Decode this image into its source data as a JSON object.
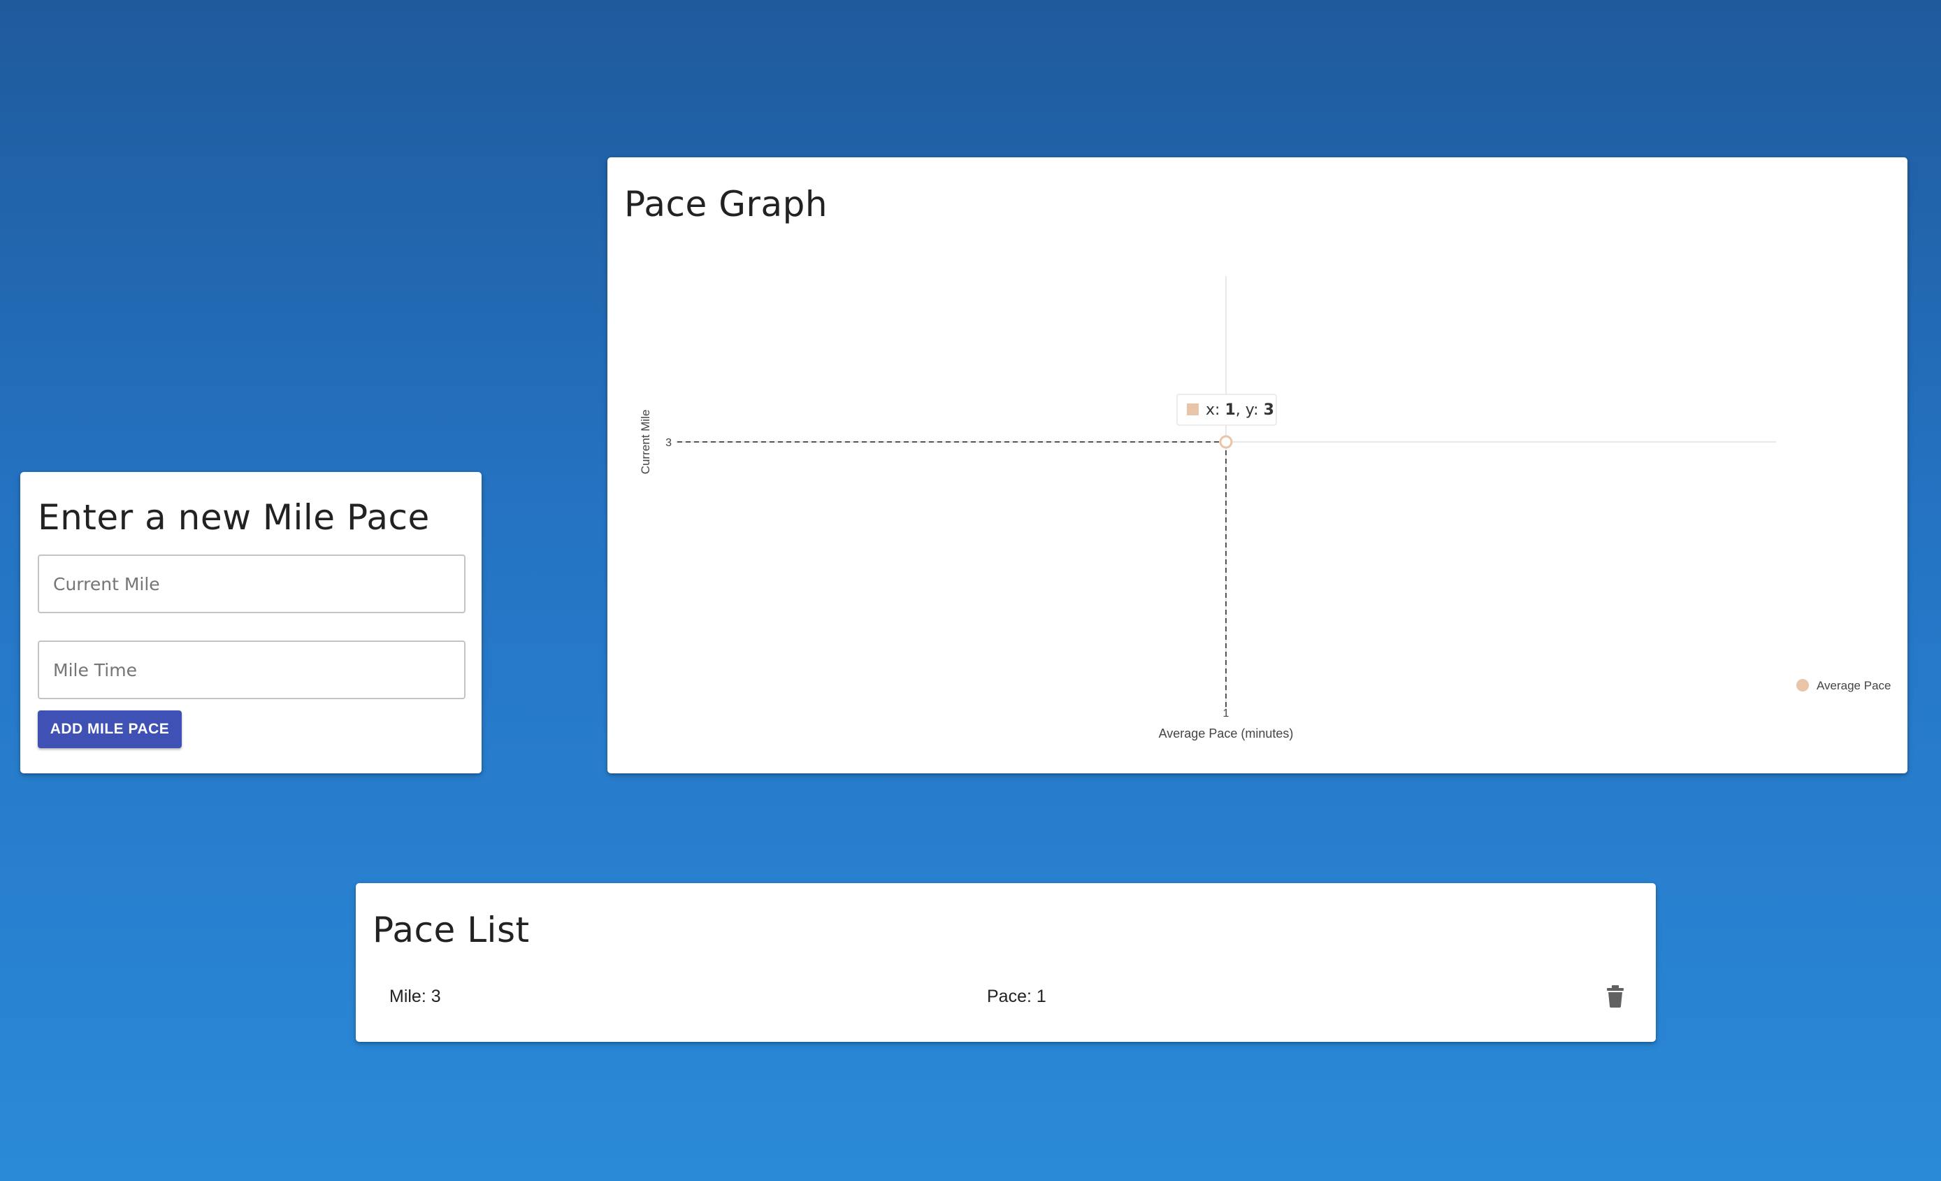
{
  "form": {
    "title": "Enter a new Mile Pace",
    "current_mile": {
      "placeholder": "Current Mile",
      "value": ""
    },
    "mile_time": {
      "placeholder": "Mile Time",
      "value": ""
    },
    "add_button_label": "Add Mile Pace",
    "accent_color": "#3f51b5"
  },
  "graph": {
    "title": "Pace Graph",
    "tooltip": {
      "x_label": "x: ",
      "x_value": "1",
      "sep": ", y: ",
      "y_value": "3"
    }
  },
  "chart_data": {
    "type": "scatter",
    "title": "",
    "xlabel": "Average Pace (minutes)",
    "ylabel": "Current Mile",
    "x_ticks": [
      "1"
    ],
    "y_ticks": [
      "3"
    ],
    "series": [
      {
        "name": "Average Pace",
        "color": "#e8c4a8",
        "points": [
          {
            "x": 1,
            "y": 3
          }
        ]
      }
    ],
    "grid": true,
    "legend_position": "bottom-right",
    "crosshair_on_point": true
  },
  "list": {
    "title": "Pace List",
    "items": [
      {
        "mile": "Mile: 3",
        "pace": "Pace: 1"
      }
    ],
    "delete_icon": "trash-icon"
  }
}
